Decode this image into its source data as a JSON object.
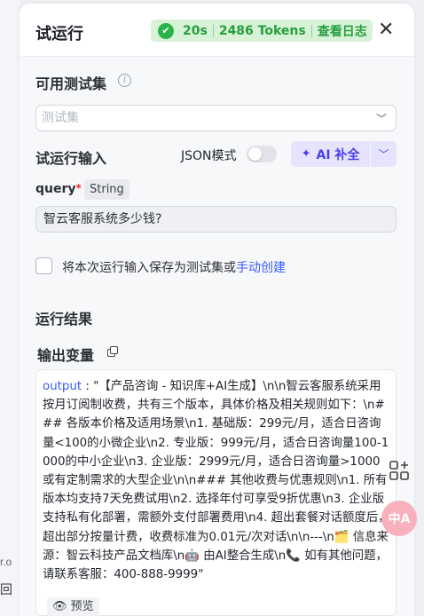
{
  "background": {
    "frag1": "r.o",
    "frag2": "回"
  },
  "header": {
    "title": "试运行",
    "status": {
      "time": "20s",
      "tokens": "2486 Tokens",
      "log_link": "查看日志"
    }
  },
  "testset": {
    "label": "可用测试集",
    "placeholder": "测试集"
  },
  "run_input": {
    "label": "试运行输入",
    "json_mode_label": "JSON模式",
    "json_mode_on": false,
    "ai_button_label": "AI 补全",
    "query": {
      "name": "query",
      "required_mark": "*",
      "type": "String",
      "value": "智云客服系统多少钱?"
    }
  },
  "save_option": {
    "text": "将本次运行输入保存为测试集或",
    "link": "手动创建"
  },
  "results": {
    "label": "运行结果",
    "output_label": "输出变量",
    "output_key": "output",
    "output_value": "\"【产品咨询 - 知识库+AI生成】\\n\\n智云客服系统采用按月订阅制收费，共有三个版本，具体价格及相关规则如下：\\n### 各版本价格及适用场景\\n1. 基础版：299元/月，适合日咨询量<100的小微企业\\n2. 专业版：999元/月，适合日咨询量100-1000的中小企业\\n3. 企业版：2999元/月，适合日咨询量>1000或有定制需求的大型企业\\n\\n### 其他收费与优惠规则\\n1. 所有版本均支持7天免费试用\\n2. 选择年付可享受9折优惠\\n3. 企业版支持私有化部署，需额外支付部署费用\\n4. 超出套餐对话额度后，超出部分按量计费，收费标准为0.01元/次对话\\n\\n---\\n🗂️ 信息来源：智云科技产品文档库\\n🤖 由AI整合生成\\n📞 如有其他问题，请联系客服：400-888-9999\"",
    "preview_label": "预览"
  },
  "float": {
    "translate_label": "中A"
  }
}
